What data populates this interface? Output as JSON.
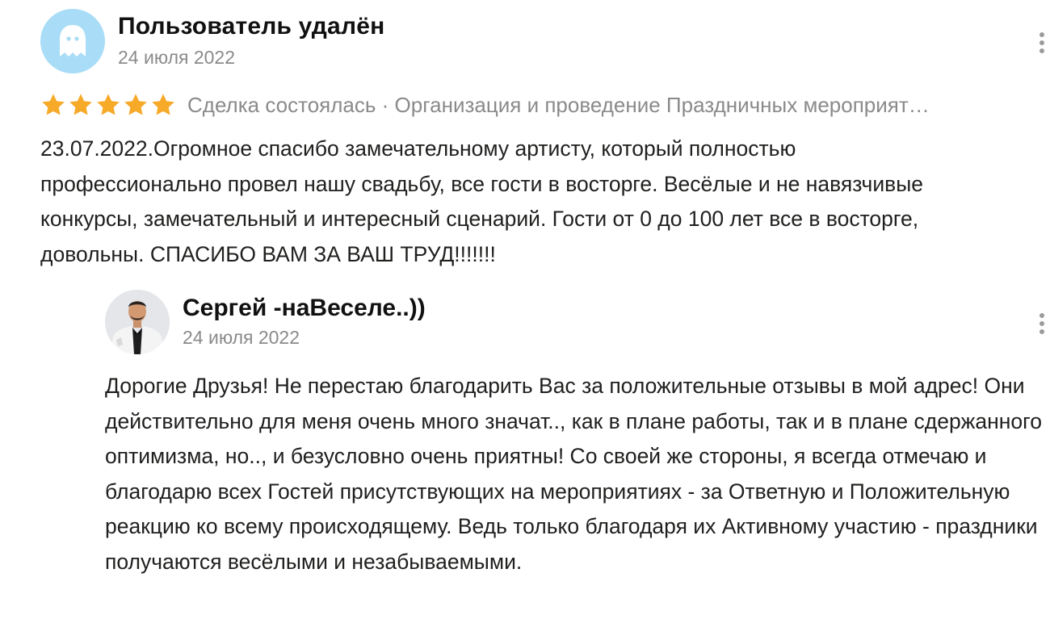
{
  "review": {
    "author": "Пользователь удалён",
    "date": "24 июля 2022",
    "rating": 5,
    "meta": "Сделка состоялась · Организация и проведение Праздничных мероприят…",
    "text": "23.07.2022.Огромное спасибо замечательному артисту, который полностью профессионально провел нашу свадьбу, все гости в восторге. Весёлые и не навязчивые конкурсы, замечательный и интересный сценарий. Гости от 0 до 100 лет все в восторге, довольны. СПАСИБО ВАМ ЗА ВАШ ТРУД!!!!!!!"
  },
  "reply": {
    "author": "Сергей -наВеселе..))",
    "date": "24 июля 2022",
    "text": "Дорогие Друзья! Не перестаю благодарить Вас за положительные отзывы в мой адрес! Они действительно для меня очень много значат.., как в плане работы, так и в плане сдержанного оптимизма, но.., и безусловно очень приятны! Со своей же стороны, я всегда отмечаю и благодарю всех Гостей присутствующих на мероприятиях - за Ответную и Положительную реакцию ко всему происходящему. Ведь только благодаря их Активному участию - праздники получаются весёлыми и незабываемыми."
  },
  "icons": {
    "review_avatar": "ghost-icon",
    "star": "star-icon",
    "menu": "more-vertical-icon"
  },
  "colors": {
    "star": "#f7a928",
    "avatar_bg": "#a9dcf7",
    "secondary_text": "#8a8a8a",
    "primary_text": "#21201f"
  }
}
